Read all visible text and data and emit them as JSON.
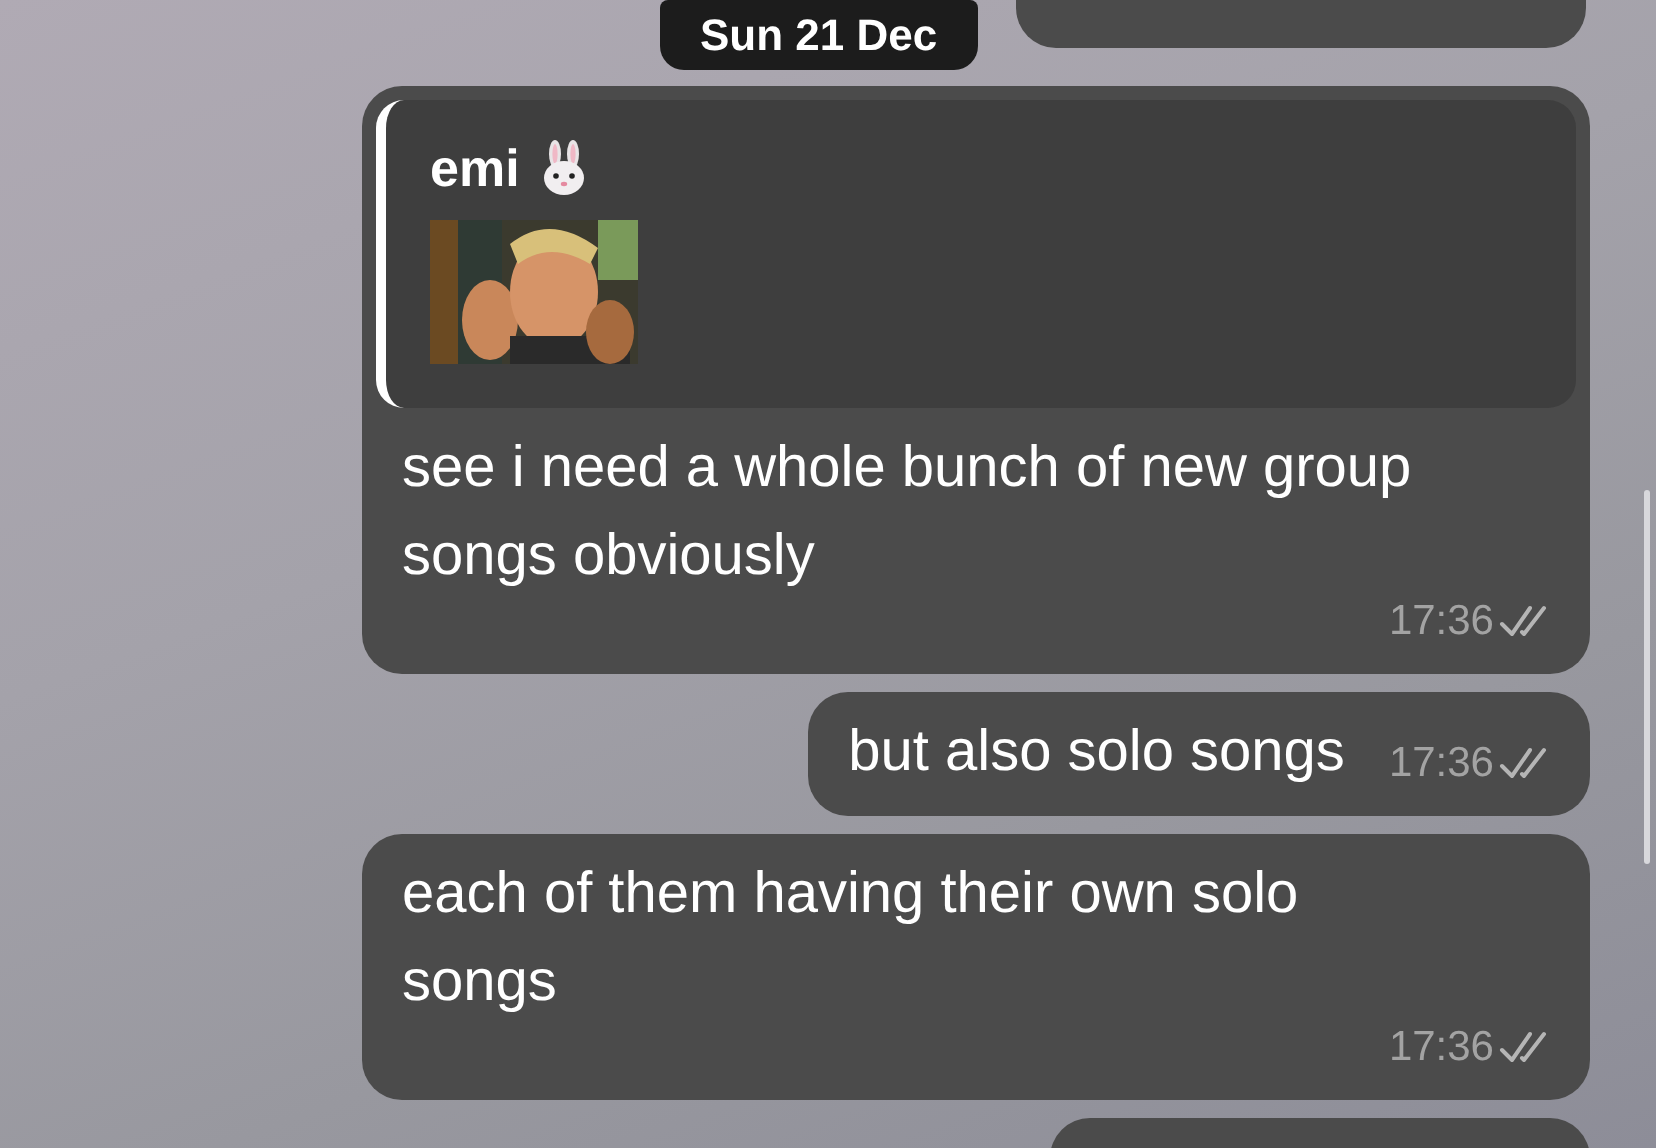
{
  "date_badge": "Sun 21 Dec",
  "messages": [
    {
      "reply_to": {
        "author": "emi"
      },
      "text": "see i need a whole bunch of new group songs obviously",
      "time": "17:36",
      "read": true
    },
    {
      "text": "but also solo songs",
      "time": "17:36",
      "read": true
    },
    {
      "text": "each of them having their own solo songs",
      "time": "17:36",
      "read": true
    }
  ]
}
